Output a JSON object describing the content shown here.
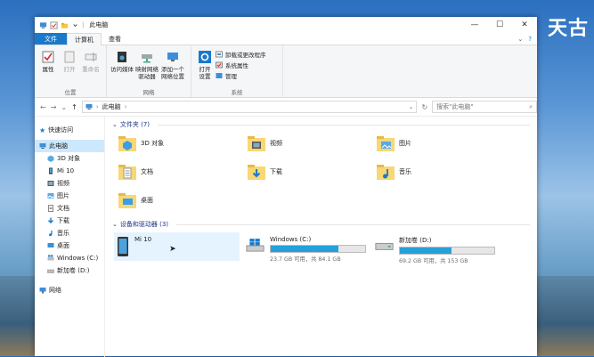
{
  "desktop": {
    "overlay_text": "天古"
  },
  "window": {
    "title": "此电脑",
    "controls": {
      "minimize": "—",
      "maximize": "☐",
      "close": "✕"
    }
  },
  "tabs": {
    "file": "文件",
    "computer": "计算机",
    "view": "查看"
  },
  "ribbon": {
    "groups": {
      "location": {
        "label": "位置",
        "buttons": {
          "properties": "属性",
          "open": "打开",
          "rename": "重命名"
        }
      },
      "network": {
        "label": "网络",
        "buttons": {
          "access_media": "访问媒体",
          "map_drive": "映射网络\n驱动器",
          "add_location": "添加一个\n网络位置"
        }
      },
      "system": {
        "label": "系统",
        "open_settings": "打开\n设置",
        "items": [
          "卸载或更改程序",
          "系统属性",
          "管理"
        ]
      }
    }
  },
  "address": {
    "path": "此电脑",
    "search_placeholder": "搜索\"此电脑\""
  },
  "nav_pane": {
    "quick_access": "快速访问",
    "this_pc": "此电脑",
    "items": [
      "3D 对象",
      "Mi 10",
      "视频",
      "图片",
      "文档",
      "下载",
      "音乐",
      "桌面",
      "Windows (C:)",
      "新加卷 (D:)"
    ],
    "network": "网络"
  },
  "folders": {
    "header": "文件夹 (7)",
    "items": [
      "3D 对象",
      "视频",
      "图片",
      "文档",
      "下载",
      "音乐",
      "桌面"
    ]
  },
  "devices": {
    "header": "设备和驱动器 (3)",
    "items": [
      {
        "name": "Mi 10"
      },
      {
        "name": "Windows (C:)",
        "info": "23.7 GB 可用，共 84.1 GB",
        "used": 0.72
      },
      {
        "name": "新加卷 (D:)",
        "info": "69.2 GB 可用，共 153 GB",
        "used": 0.55
      }
    ]
  },
  "colors": {
    "accent": "#1979ca",
    "selection": "#cce8ff",
    "bar_fill": "#26a0da"
  }
}
